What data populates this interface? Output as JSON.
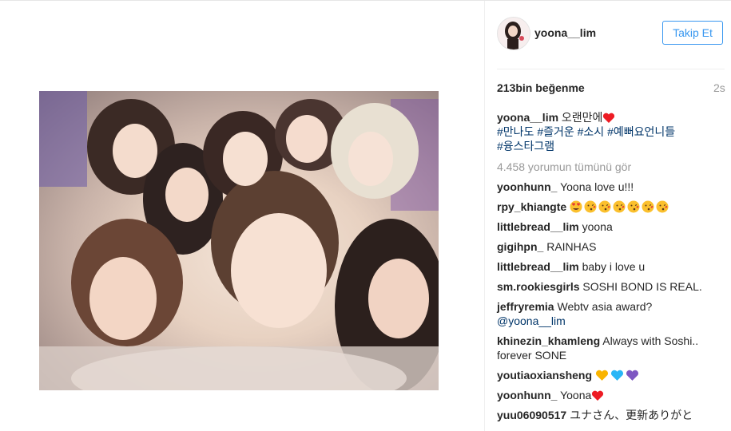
{
  "post": {
    "username": "yoona__lim",
    "follow_label": "Takip Et",
    "likes": "213bin beğenme",
    "time": "2s"
  },
  "caption": {
    "username": "yoona__lim",
    "text": "오랜만에",
    "hashtags_line1": "#만나도 #즐거운 #소시 #예뻐요언니들",
    "hashtags_line2": "#융스타그램"
  },
  "view_all": "4.458 yorumun tümünü gör",
  "comments": [
    {
      "user": "yoonhunn_",
      "text": "Yoona love u!!!"
    },
    {
      "user": "rpy_khiangte",
      "text": ""
    },
    {
      "user": "littlebread__lim",
      "text": "yoona"
    },
    {
      "user": "gigihpn_",
      "text": "RAINHAS"
    },
    {
      "user": "littlebread__lim",
      "text": "baby i love u"
    },
    {
      "user": "sm.rookiesgirls",
      "text": "SOSHI BOND IS REAL."
    },
    {
      "user": "jeffryremia",
      "text": "Webtv asia award?",
      "mention": "@yoona__lim"
    },
    {
      "user": "khinezin_khamleng",
      "text": "Always with Soshi..",
      "text2": "forever SONE"
    },
    {
      "user": "youtiaoxiansheng",
      "text": ""
    },
    {
      "user": "yoonhunn_",
      "text": "Yoona"
    },
    {
      "user": "yuu06090517",
      "text": "ユナさん、更新ありがと"
    }
  ],
  "colors": {
    "follow_blue": "#3897f0",
    "hashtag": "#003569",
    "muted": "#999999",
    "heart": "#ed1c24"
  }
}
